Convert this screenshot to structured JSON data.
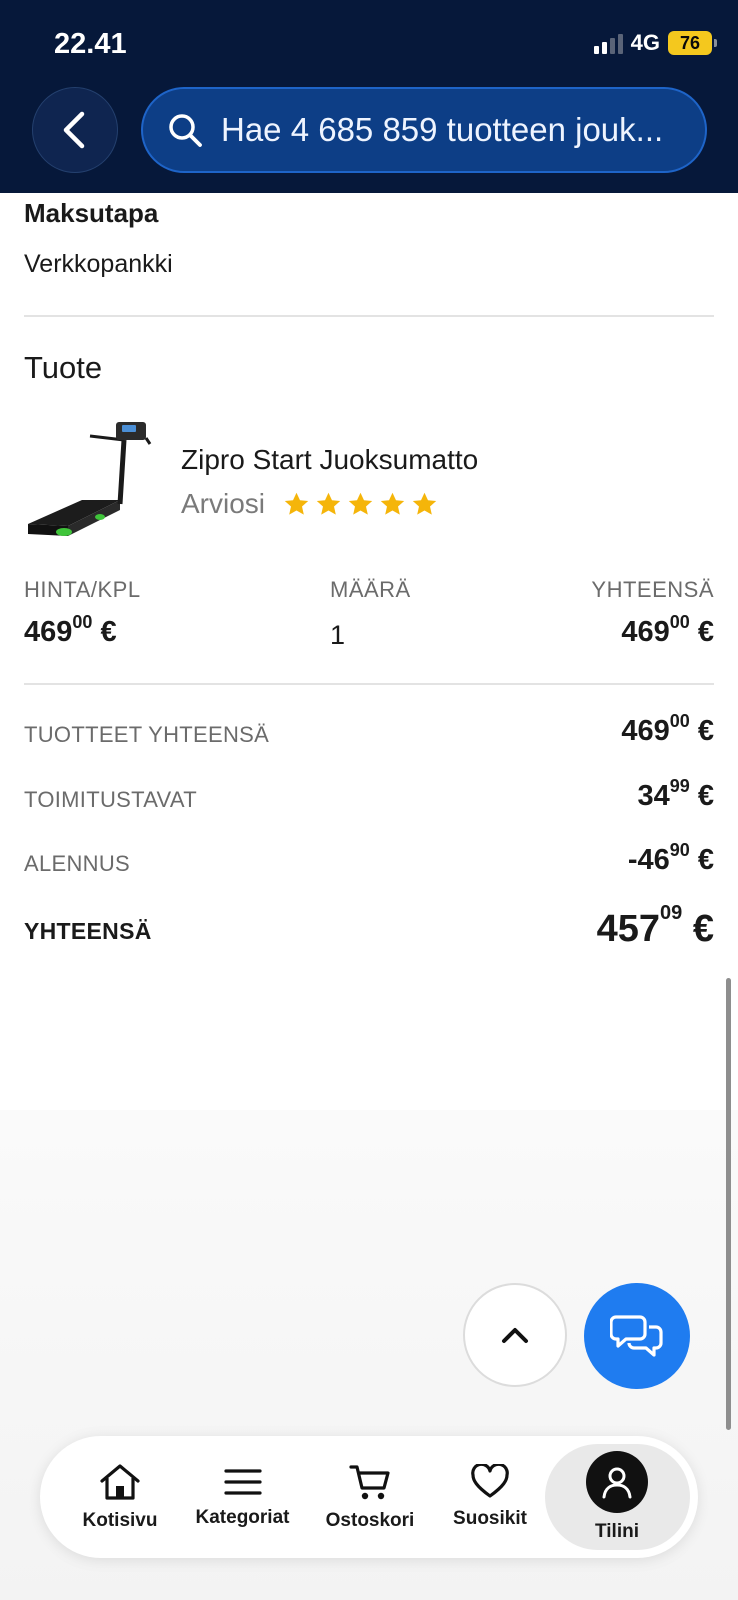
{
  "status_bar": {
    "time": "22.41",
    "network": "4G",
    "battery": "76"
  },
  "header": {
    "search_placeholder": "Hae 4 685 859 tuotteen jouk..."
  },
  "payment": {
    "heading": "Maksutapa",
    "method": "Verkkopankki"
  },
  "product_section": {
    "title": "Tuote",
    "product_name": "Zipro Start Juoksumatto",
    "rating_label": "Arviosi",
    "rating": 5,
    "rating_max": 5,
    "star_color": "#f5b50a"
  },
  "line_item": {
    "headers": {
      "unit_price": "HINTA/KPL",
      "quantity": "MÄÄRÄ",
      "total": "YHTEENSÄ"
    },
    "unit_price": {
      "main": "469",
      "cents": "00",
      "currency": "€"
    },
    "quantity": "1",
    "total": {
      "main": "469",
      "cents": "00",
      "currency": "€"
    }
  },
  "summary": {
    "products_total": {
      "label": "TUOTTEET YHTEENSÄ",
      "main": "469",
      "cents": "00",
      "currency": "€"
    },
    "shipping": {
      "label": "TOIMITUSTAVAT",
      "main": "34",
      "cents": "99",
      "currency": "€"
    },
    "discount": {
      "label": "ALENNUS",
      "main": "-46",
      "cents": "90",
      "currency": "€"
    },
    "grand_total": {
      "label": "YHTEENSÄ",
      "main": "457",
      "cents": "09",
      "currency": "€"
    }
  },
  "bottom_nav": {
    "items": [
      {
        "label": "Kotisivu",
        "icon": "home-icon"
      },
      {
        "label": "Kategoriat",
        "icon": "menu-icon"
      },
      {
        "label": "Ostoskori",
        "icon": "cart-icon"
      },
      {
        "label": "Suosikit",
        "icon": "heart-icon"
      },
      {
        "label": "Tilini",
        "icon": "account-icon",
        "active": true
      }
    ]
  },
  "colors": {
    "header_bg": "#06183a",
    "search_bg": "#0d3e86",
    "chat_button": "#1f7cf0",
    "battery": "#f4c81e"
  }
}
